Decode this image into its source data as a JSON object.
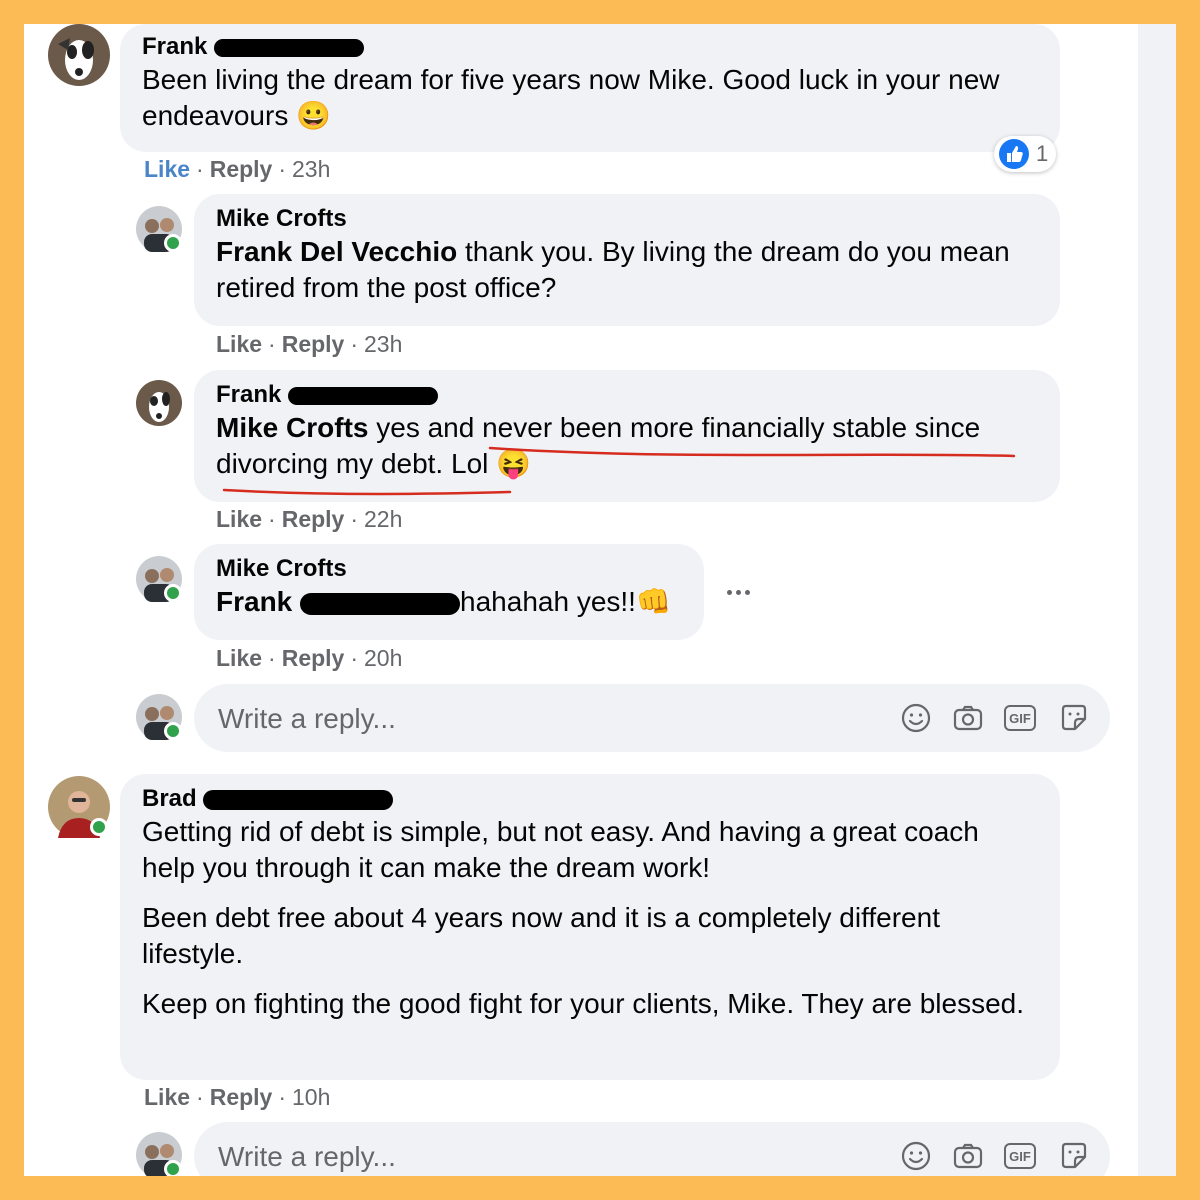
{
  "comments": [
    {
      "author": "Frank",
      "text": "Been living the dream for five years now Mike. Good luck in your new endeavours",
      "emoji": "😀",
      "like": "Like",
      "reply": "Reply",
      "time": "23h",
      "reaction_count": "1"
    },
    {
      "author": "Mike Crofts",
      "mention": "Frank Del Vecchio",
      "text": " thank you. By living the dream do you mean retired from the post office?",
      "like": "Like",
      "reply": "Reply",
      "time": "23h"
    },
    {
      "author": "Frank",
      "mention": "Mike Crofts",
      "text_before": " yes and ",
      "text_underlined": "never been more financially stable since divorcing my debt.",
      "text_after": " Lol",
      "emoji": "😝",
      "like": "Like",
      "reply": "Reply",
      "time": "22h"
    },
    {
      "author": "Mike Crofts",
      "mention": "Frank",
      "text": "hahahah yes!!",
      "emoji": "👊",
      "like": "Like",
      "reply": "Reply",
      "time": "20h"
    },
    {
      "author": "Brad",
      "paragraph1": "Getting rid of debt is simple, but not easy. And having a great coach help you through it can make the dream work!",
      "paragraph2": "Been debt free about 4 years now and it is a completely different lifestyle.",
      "paragraph3": "Keep on fighting the good fight for your clients, Mike. They are blessed.",
      "like": "Like",
      "reply": "Reply",
      "time": "10h"
    }
  ],
  "reply_box": {
    "placeholder": "Write a reply...",
    "gif_label": "GIF"
  },
  "colors": {
    "frame": "#fdbb55",
    "bubble": "#f0f2f5",
    "online": "#31a24c",
    "like_blue": "#1877f2",
    "annotation_red": "#d62b1f"
  },
  "icons": [
    "emoji-icon",
    "camera-icon",
    "gif-icon",
    "sticker-icon",
    "thumbs-up-icon",
    "more-options-icon"
  ]
}
